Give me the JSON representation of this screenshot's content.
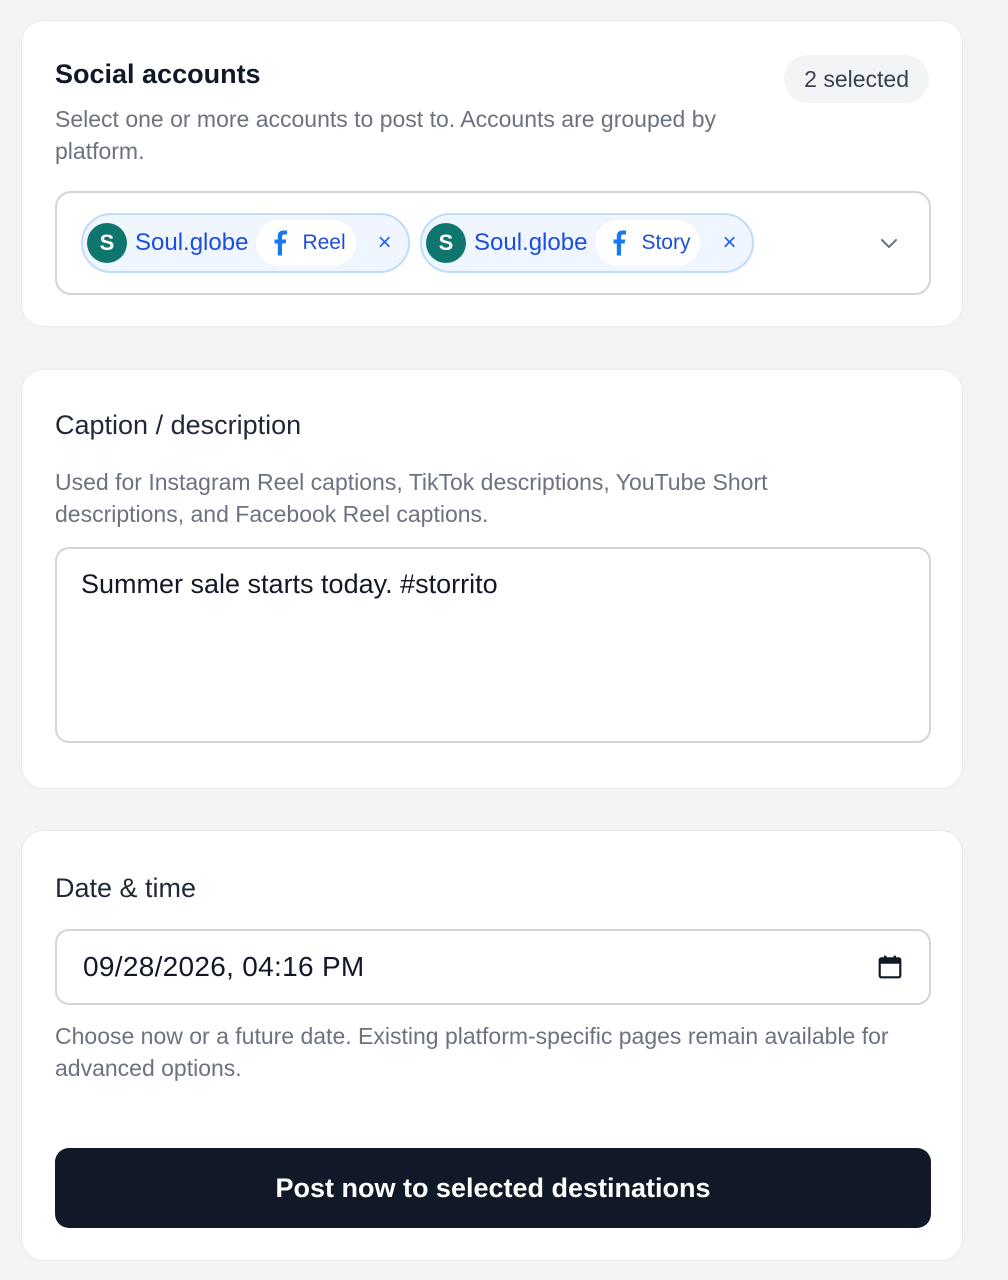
{
  "accounts": {
    "title": "Social accounts",
    "badge": "2 selected",
    "help": "Select one or more accounts to post to. Accounts are grouped by platform.",
    "chips": [
      {
        "initial": "S",
        "name": "Soul.globe",
        "platform_icon": "facebook-icon",
        "type": "Reel",
        "remove": "×"
      },
      {
        "initial": "S",
        "name": "Soul.globe",
        "platform_icon": "facebook-icon",
        "type": "Story",
        "remove": "×"
      }
    ]
  },
  "caption": {
    "label": "Caption / description",
    "help": "Used for Instagram Reel captions, TikTok descriptions, YouTube Short descriptions, and Facebook Reel captions.",
    "value": "Summer sale starts today. #storrito"
  },
  "datetime": {
    "label": "Date & time",
    "value": "09/28/2026, 04:16 PM",
    "help": "Choose now or a future date. Existing platform-specific pages remain available for advanced options."
  },
  "submit_label": "Post now to selected destinations",
  "colors": {
    "avatar": "#0f766e",
    "chip_text": "#1d4ed8",
    "chip_border": "#bfdbfe",
    "facebook": "#1877f2",
    "button": "#111827"
  }
}
